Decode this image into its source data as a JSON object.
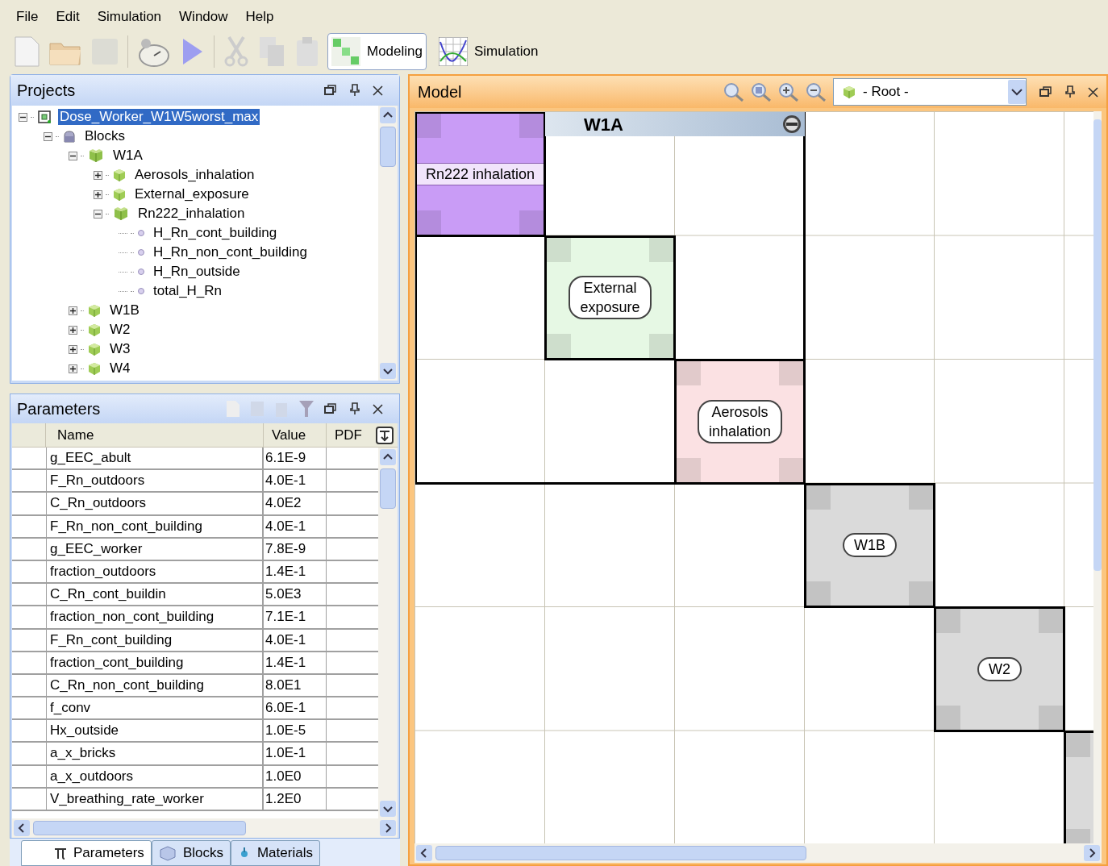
{
  "menu": [
    "File",
    "Edit",
    "Simulation",
    "Window",
    "Help"
  ],
  "toolbar": {
    "modes": [
      {
        "label": "Modeling",
        "selected": true
      },
      {
        "label": "Simulation",
        "selected": false
      }
    ]
  },
  "projects": {
    "title": "Projects",
    "tree": [
      {
        "label": "Dose_Worker_W1W5worst_max",
        "kind": "project",
        "selected": true,
        "expanded": true,
        "children": [
          {
            "label": "Blocks",
            "kind": "folder",
            "selected": false,
            "expanded": true,
            "children": [
              {
                "label": "W1A",
                "kind": "open-block",
                "selected": false,
                "expanded": true,
                "children": [
                  {
                    "label": "Aerosols_inhalation",
                    "kind": "block",
                    "selected": false,
                    "expanded": false
                  },
                  {
                    "label": "External_exposure",
                    "kind": "block",
                    "selected": false,
                    "expanded": false
                  },
                  {
                    "label": "Rn222_inhalation",
                    "kind": "open-block",
                    "selected": false,
                    "expanded": true,
                    "children": [
                      {
                        "label": "H_Rn_cont_building",
                        "kind": "variable",
                        "selected": false
                      },
                      {
                        "label": "H_Rn_non_cont_building",
                        "kind": "variable",
                        "selected": false
                      },
                      {
                        "label": "H_Rn_outside",
                        "kind": "variable",
                        "selected": false
                      },
                      {
                        "label": "total_H_Rn",
                        "kind": "variable",
                        "selected": false
                      }
                    ]
                  }
                ]
              },
              {
                "label": "W1B",
                "kind": "block",
                "selected": false,
                "expanded": false
              },
              {
                "label": "W2",
                "kind": "block",
                "selected": false,
                "expanded": false
              },
              {
                "label": "W3",
                "kind": "block",
                "selected": false,
                "expanded": false
              },
              {
                "label": "W4",
                "kind": "block",
                "selected": false,
                "expanded": false
              }
            ]
          }
        ]
      }
    ]
  },
  "parameters": {
    "title": "Parameters",
    "columns": [
      "Name",
      "Value",
      "PDF"
    ],
    "rows": [
      {
        "name": "g_EEC_abult",
        "value": "6.1E-9"
      },
      {
        "name": "F_Rn_outdoors",
        "value": "4.0E-1"
      },
      {
        "name": "C_Rn_outdoors",
        "value": "4.0E2"
      },
      {
        "name": "F_Rn_non_cont_building",
        "value": "4.0E-1"
      },
      {
        "name": "g_EEC_worker",
        "value": "7.8E-9"
      },
      {
        "name": "fraction_outdoors",
        "value": "1.4E-1"
      },
      {
        "name": "C_Rn_cont_buildin",
        "value": "5.0E3"
      },
      {
        "name": "fraction_non_cont_building",
        "value": "7.1E-1"
      },
      {
        "name": "F_Rn_cont_building",
        "value": "4.0E-1"
      },
      {
        "name": "fraction_cont_building",
        "value": "1.4E-1"
      },
      {
        "name": "C_Rn_non_cont_building",
        "value": "8.0E1"
      },
      {
        "name": "f_conv",
        "value": "6.0E-1"
      },
      {
        "name": "Hx_outside",
        "value": "1.0E-5"
      },
      {
        "name": "a_x_bricks",
        "value": "1.0E-1"
      },
      {
        "name": "a_x_outdoors",
        "value": "1.0E0"
      },
      {
        "name": "V_breathing_rate_worker",
        "value": "1.2E0"
      }
    ]
  },
  "bottom_tabs": [
    {
      "label": "Parameters",
      "selected": true
    },
    {
      "label": "Blocks",
      "selected": false
    },
    {
      "label": "Materials",
      "selected": false
    }
  ],
  "model": {
    "title": "Model",
    "root_select": "- Root -",
    "group_title": "W1A",
    "blocks": [
      {
        "label": "Rn222 inhalation",
        "kind": "band",
        "color": "#c99cf6"
      },
      {
        "label": "External\nexposure",
        "kind": "pill",
        "color": "#e6f8e4"
      },
      {
        "label": "Aerosols\ninhalation",
        "kind": "pill",
        "color": "#fbe1e3"
      },
      {
        "label": "W1B",
        "kind": "pill",
        "color": "#dadada"
      },
      {
        "label": "W2",
        "kind": "pill",
        "color": "#dadada"
      },
      {
        "kind": "stub",
        "color": "#dadada"
      }
    ]
  }
}
